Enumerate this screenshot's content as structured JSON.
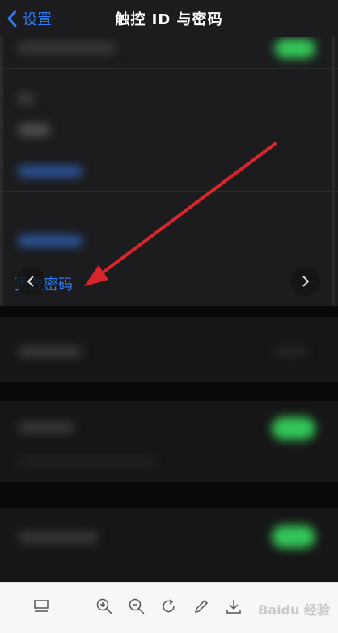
{
  "header": {
    "back_label": "设置",
    "title": "触控 ID 与密码"
  },
  "main": {
    "change_passcode_label": "更改密码"
  },
  "toolbar": {
    "watermark": "Baidu 经验",
    "icons": [
      "layout-icon",
      "zoom-in-icon",
      "zoom-out-icon",
      "rotate-icon",
      "edit-icon",
      "download-icon"
    ]
  },
  "colors": {
    "accent": "#2f7df6",
    "toggle_green": "#34c759",
    "arrow_red": "#d9262c"
  }
}
